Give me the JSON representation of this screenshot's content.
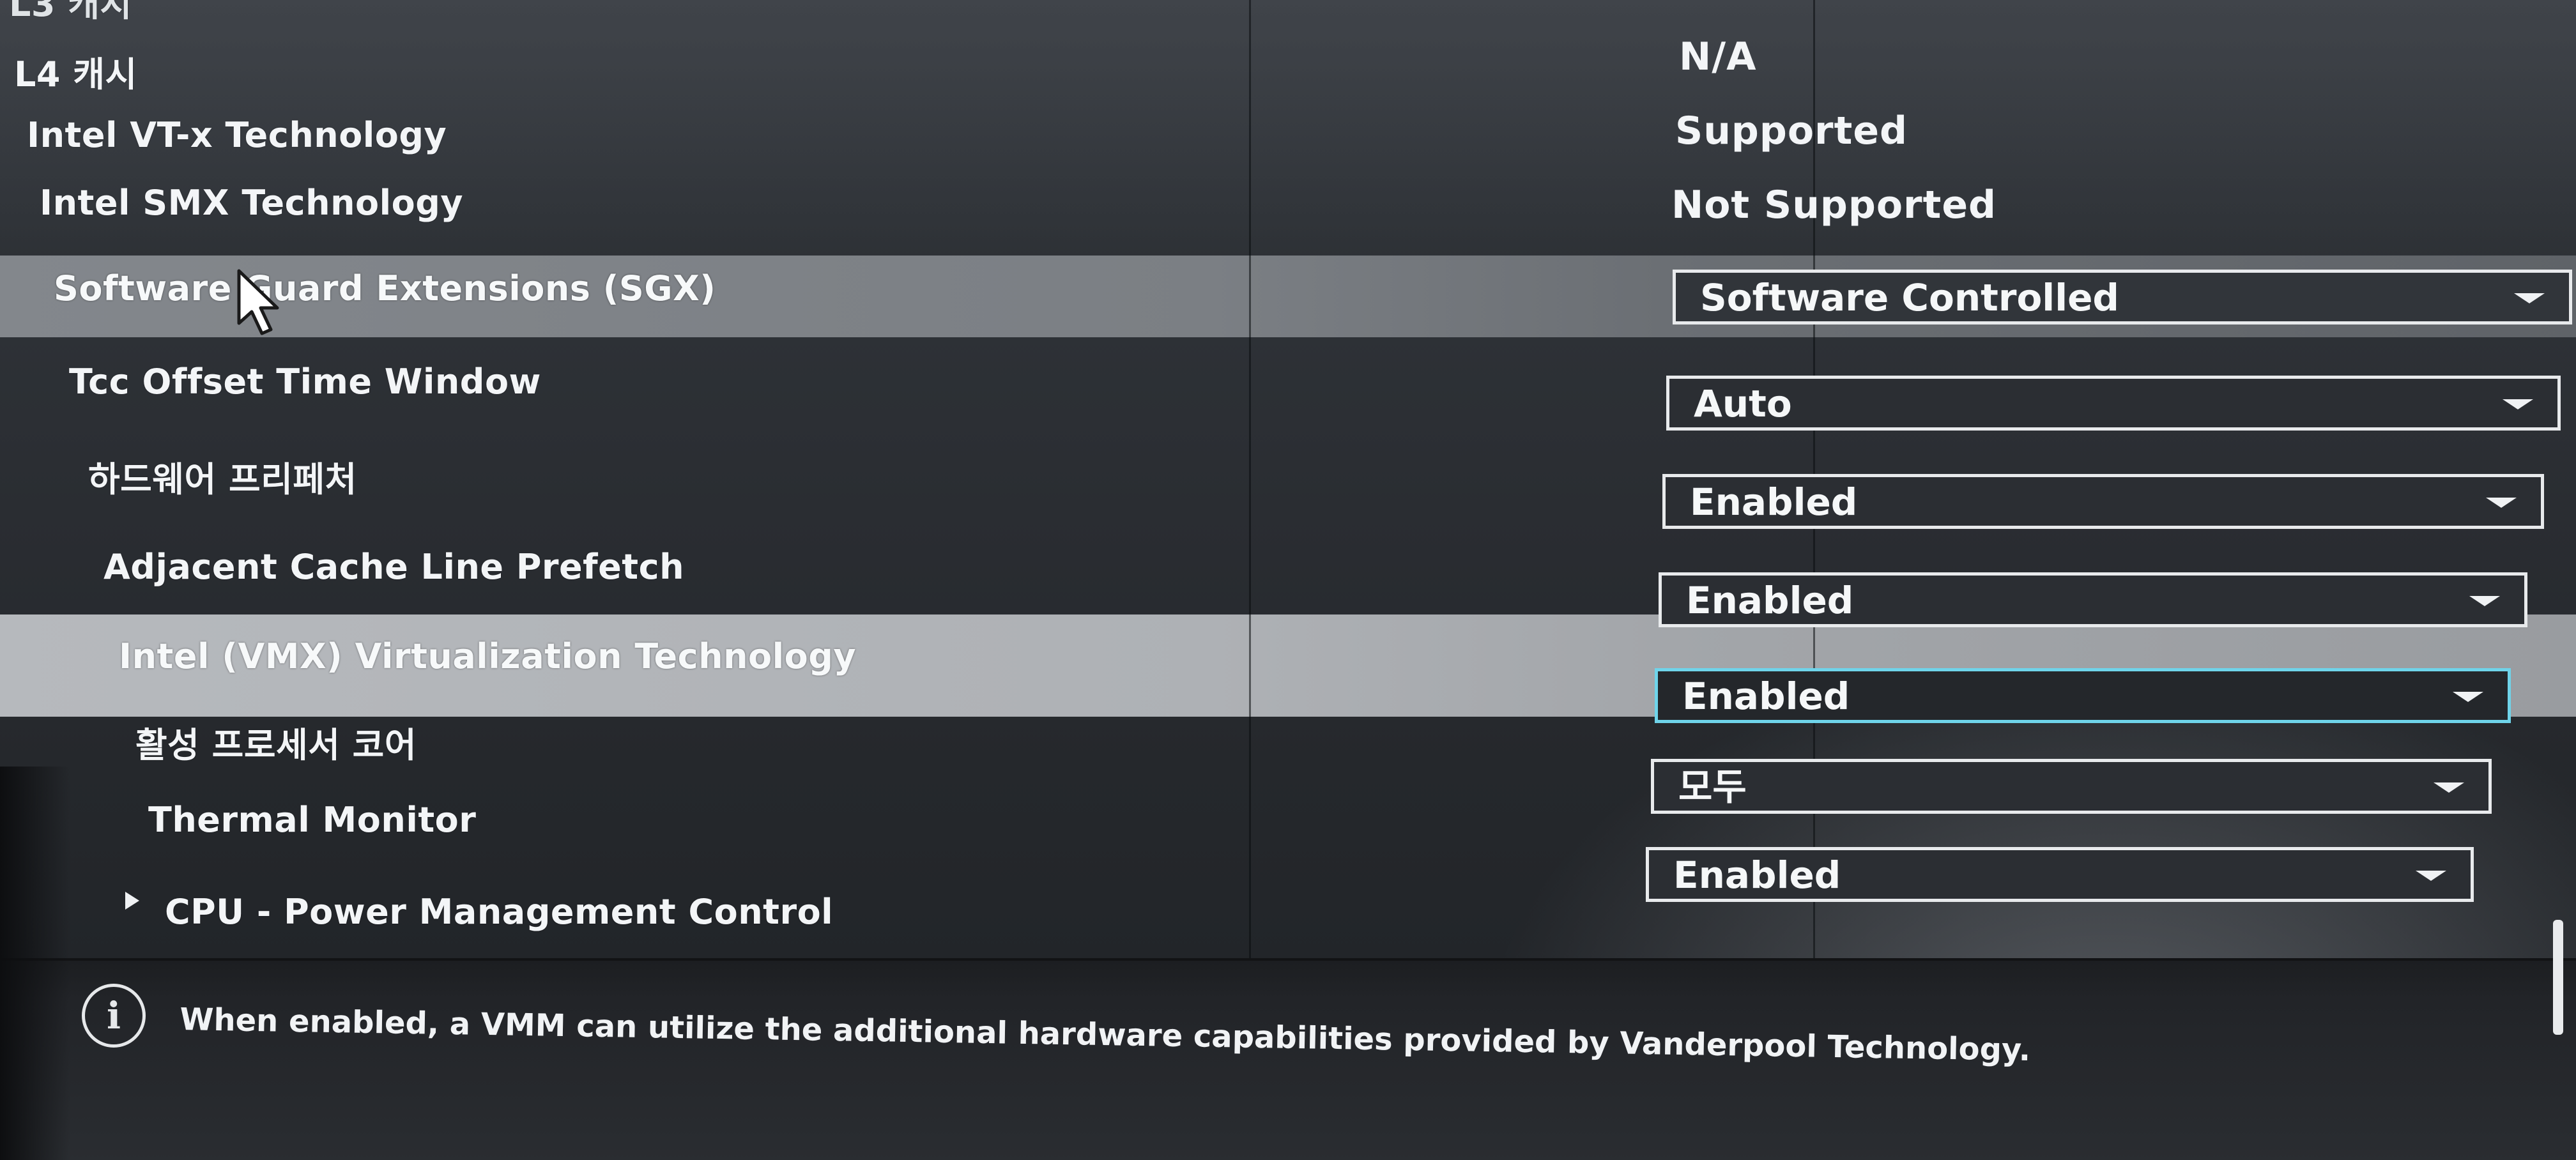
{
  "settings": {
    "l3_cut_label": "L3 캐시",
    "l4_label": "L4 캐시",
    "l4_value": "N/A",
    "vtx_label": "Intel VT-x Technology",
    "vtx_value": "Supported",
    "smx_label": "Intel SMX Technology",
    "smx_value": "Not Supported",
    "sgx_label": "Software Guard Extensions (SGX)",
    "sgx_value": "Software Controlled",
    "tcc_label": "Tcc Offset Time Window",
    "tcc_value": "Auto",
    "hw_prefetch_label": "하드웨어 프리페처",
    "hw_prefetch_value": "Enabled",
    "adjacent_label": "Adjacent Cache Line Prefetch",
    "adjacent_value": "Enabled",
    "vmx_label": "Intel (VMX) Virtualization Technology",
    "vmx_value": "Enabled",
    "active_cores_label": "활성 프로세서 코어",
    "active_cores_value": "모두",
    "thermal_label": "Thermal Monitor",
    "thermal_value": "Enabled",
    "cpu_power_label": "CPU - Power Management Control"
  },
  "help": {
    "icon": "info-icon",
    "text": "When enabled, a VMM can utilize the additional hardware capabilities provided by Vanderpool Technology."
  },
  "colors": {
    "focus_border": "#6fd4ea",
    "selected_row": "#aeb1b5",
    "hover_row": "#7b7f84"
  },
  "icons": {
    "cursor": "mouse-pointer-icon",
    "dropdown": "chevron-down-icon",
    "submenu": "submenu-arrow-icon"
  }
}
